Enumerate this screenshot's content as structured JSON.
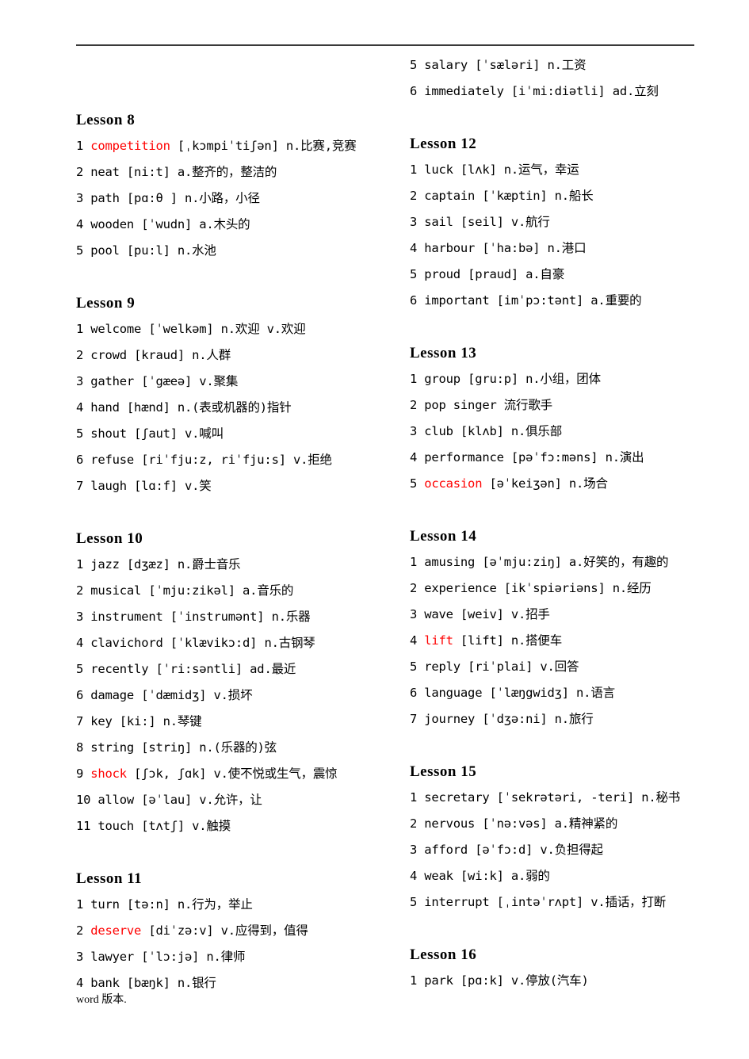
{
  "footer": {
    "text": "word 版本."
  },
  "colors": {
    "highlight": "#ff0000",
    "text": "#000000",
    "rule": "#3a3a3a"
  },
  "left_column": [
    {
      "title": "Lesson 8",
      "entries": [
        {
          "num": "1",
          "word": "competition",
          "phonetic": "[ˌkɔmpiˈtiʃən]",
          "meaning": "n.比赛,竞赛",
          "highlight": true
        },
        {
          "num": "2",
          "word": "neat",
          "phonetic": "[ni:t]",
          "meaning": "a.整齐的，整洁的",
          "highlight": false
        },
        {
          "num": "3",
          "word": "path",
          "phonetic": "[pɑ:θ ]",
          "meaning": "n.小路，小径",
          "highlight": false
        },
        {
          "num": "4",
          "word": "wooden",
          "phonetic": "[ˈwudn]",
          "meaning": "a.木头的",
          "highlight": false
        },
        {
          "num": "5",
          "word": "pool",
          "phonetic": "[pu:l]",
          "meaning": "n.水池",
          "highlight": false
        }
      ]
    },
    {
      "title": "Lesson 9",
      "entries": [
        {
          "num": "1",
          "word": "welcome",
          "phonetic": "[ˈwelkəm]",
          "meaning": "n.欢迎 v.欢迎",
          "highlight": false
        },
        {
          "num": "2",
          "word": "crowd",
          "phonetic": "[kraud]",
          "meaning": "n.人群",
          "highlight": false
        },
        {
          "num": "3",
          "word": "gather",
          "phonetic": "[ˈgæeə]",
          "meaning": "v.聚集",
          "highlight": false
        },
        {
          "num": "4",
          "word": "hand",
          "phonetic": "[hænd]",
          "meaning": "n.(表或机器的)指针",
          "highlight": false
        },
        {
          "num": "5",
          "word": "shout",
          "phonetic": "[ʃaut]",
          "meaning": "v.喊叫",
          "highlight": false
        },
        {
          "num": "6",
          "word": "refuse",
          "phonetic": "[riˈfju:z, riˈfju:s]",
          "meaning": "v.拒绝",
          "highlight": false
        },
        {
          "num": "7",
          "word": "laugh",
          "phonetic": "[lɑ:f]",
          "meaning": "v.笑",
          "highlight": false
        }
      ]
    },
    {
      "title": "Lesson 10",
      "entries": [
        {
          "num": "1",
          "word": "jazz",
          "phonetic": "[dʒæz]",
          "meaning": "n.爵士音乐",
          "highlight": false
        },
        {
          "num": "2",
          "word": "musical",
          "phonetic": "[ˈmju:zikəl]",
          "meaning": "a.音乐的",
          "highlight": false
        },
        {
          "num": "3",
          "word": "instrument",
          "phonetic": "[ˈinstrumənt]",
          "meaning": "n.乐器",
          "highlight": false
        },
        {
          "num": "4",
          "word": "clavichord",
          "phonetic": "[ˈklævikɔ:d]",
          "meaning": "n.古钢琴",
          "highlight": false
        },
        {
          "num": "5",
          "word": "recently",
          "phonetic": "[ˈri:səntli]",
          "meaning": "ad.最近",
          "highlight": false
        },
        {
          "num": "6",
          "word": "damage",
          "phonetic": "[ˈdæmidʒ]",
          "meaning": "v.损坏",
          "highlight": false
        },
        {
          "num": "7",
          "word": "key",
          "phonetic": "[ki:]",
          "meaning": "n.琴键",
          "highlight": false
        },
        {
          "num": "8",
          "word": "string",
          "phonetic": "[striŋ]",
          "meaning": "n.(乐器的)弦",
          "highlight": false
        },
        {
          "num": "9",
          "word": "shock",
          "phonetic": "[ʃɔk, ʃɑk]",
          "meaning": "v.使不悦或生气，震惊",
          "highlight": true
        },
        {
          "num": "10",
          "word": "allow",
          "phonetic": "[əˈlau]",
          "meaning": "v.允许，让",
          "highlight": false
        },
        {
          "num": "11",
          "word": "touch",
          "phonetic": "[tʌtʃ]",
          "meaning": "v.触摸",
          "highlight": false
        }
      ]
    },
    {
      "title": "Lesson 11",
      "entries": [
        {
          "num": "1",
          "word": "turn",
          "phonetic": "[tə:n]",
          "meaning": "n.行为，举止",
          "highlight": false
        },
        {
          "num": "2",
          "word": "deserve",
          "phonetic": "[diˈzə:v]",
          "meaning": "v.应得到，值得",
          "highlight": true
        },
        {
          "num": "3",
          "word": "lawyer",
          "phonetic": "[ˈlɔ:jə]",
          "meaning": "n.律师",
          "highlight": false
        },
        {
          "num": "4",
          "word": "bank",
          "phonetic": "[bæŋk]",
          "meaning": "n.银行",
          "highlight": false
        }
      ]
    }
  ],
  "right_column": [
    {
      "title": "",
      "entries": [
        {
          "num": "5",
          "word": "salary",
          "phonetic": " [ˈsæləri]",
          "meaning": "n.工资",
          "highlight": false
        },
        {
          "num": "6",
          "word": "immediately",
          "phonetic": " [iˈmi:diətli]",
          "meaning": "ad.立刻",
          "highlight": false
        }
      ]
    },
    {
      "title": "Lesson 12",
      "entries": [
        {
          "num": "1",
          "word": "luck",
          "phonetic": "[lʌk]",
          "meaning": "n.运气，幸运",
          "highlight": false
        },
        {
          "num": "2",
          "word": "captain",
          "phonetic": "[ˈkæptin]",
          "meaning": "n.船长",
          "highlight": false
        },
        {
          "num": "3",
          "word": "sail",
          "phonetic": "[seil]",
          "meaning": "v.航行",
          "highlight": false
        },
        {
          "num": "4",
          "word": "harbour",
          "phonetic": "[ˈha:bə]",
          "meaning": "n.港口",
          "highlight": false
        },
        {
          "num": "5",
          "word": "proud",
          "phonetic": "  [praud]",
          "meaning": "a.自豪",
          "highlight": false
        },
        {
          "num": "6",
          "word": "important",
          "phonetic": "[imˈpɔ:tənt]",
          "meaning": "a.重要的",
          "highlight": false
        }
      ]
    },
    {
      "title": "Lesson 13",
      "entries": [
        {
          "num": "1",
          "word": "group",
          "phonetic": "[gru:p]",
          "meaning": "n.小组，团体",
          "highlight": false
        },
        {
          "num": "2",
          "word": "pop singer",
          "phonetic": "",
          "meaning": "  流行歌手",
          "highlight": false
        },
        {
          "num": "3",
          "word": "club",
          "phonetic": "[klʌb]",
          "meaning": "n.俱乐部",
          "highlight": false
        },
        {
          "num": "4",
          "word": "performance",
          "phonetic": "[pəˈfɔ:məns]",
          "meaning": "n.演出",
          "highlight": false
        },
        {
          "num": "5",
          "word": "occasion",
          "phonetic": "[əˈkeiʒən]",
          "meaning": "n.场合",
          "highlight": true
        }
      ]
    },
    {
      "title": "Lesson 14",
      "entries": [
        {
          "num": "1",
          "word": "amusing",
          "phonetic": "[əˈmju:ziŋ]",
          "meaning": "a.好笑的，有趣的",
          "highlight": false
        },
        {
          "num": "2",
          "word": "experience",
          "phonetic": "[ikˈspiəriəns]",
          "meaning": "n.经历",
          "highlight": false
        },
        {
          "num": "3",
          "word": "wave",
          "phonetic": "[weiv]",
          "meaning": "v.招手",
          "highlight": false
        },
        {
          "num": "4",
          "word": "lift",
          "phonetic": "[lift]",
          "meaning": "n.搭便车",
          "highlight": true
        },
        {
          "num": "5",
          "word": "reply",
          "phonetic": "[riˈplai]",
          "meaning": "v.回答",
          "highlight": false
        },
        {
          "num": "6",
          "word": "language",
          "phonetic": "[ˈlæŋgwidʒ]",
          "meaning": "n.语言",
          "highlight": false
        },
        {
          "num": "7",
          "word": "journey",
          "phonetic": "[ˈdʒə:ni]",
          "meaning": "n.旅行",
          "highlight": false
        }
      ]
    },
    {
      "title": "Lesson 15",
      "entries": [
        {
          "num": "1",
          "word": "secretary",
          "phonetic": "[ˈsekrətəri, -teri]",
          "meaning": "n.秘书",
          "highlight": false
        },
        {
          "num": "2",
          "word": "nervous",
          "phonetic": "[ˈnə:vəs]",
          "meaning": "a.精神紧的",
          "highlight": false
        },
        {
          "num": "3",
          "word": "afford",
          "phonetic": "[əˈfɔ:d]",
          "meaning": "v.负担得起",
          "highlight": false
        },
        {
          "num": "4",
          "word": "weak",
          "phonetic": "[wi:k]",
          "meaning": "a.弱的",
          "highlight": false
        },
        {
          "num": "5",
          "word": "interrupt",
          "phonetic": "[ˌintəˈrʌpt]",
          "meaning": "v.插话，打断",
          "highlight": false
        }
      ]
    },
    {
      "title": "Lesson 16",
      "entries": [
        {
          "num": "1",
          "word": "park",
          "phonetic": "[pɑ:k]",
          "meaning": "v.停放(汽车)",
          "highlight": false
        }
      ]
    }
  ]
}
